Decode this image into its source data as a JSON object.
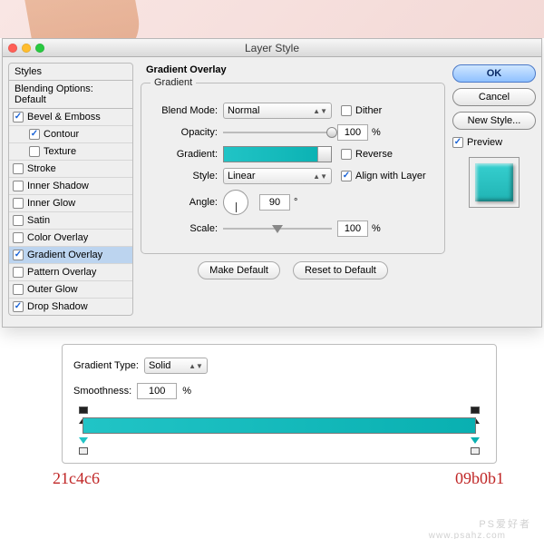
{
  "window": {
    "title": "Layer Style"
  },
  "left": {
    "styles_label": "Styles",
    "blend_label": "Blending Options: Default",
    "items": [
      {
        "label": "Bevel & Emboss",
        "checked": true,
        "indent": false
      },
      {
        "label": "Contour",
        "checked": true,
        "indent": true
      },
      {
        "label": "Texture",
        "checked": false,
        "indent": true
      },
      {
        "label": "Stroke",
        "checked": false,
        "indent": false
      },
      {
        "label": "Inner Shadow",
        "checked": false,
        "indent": false
      },
      {
        "label": "Inner Glow",
        "checked": false,
        "indent": false
      },
      {
        "label": "Satin",
        "checked": false,
        "indent": false
      },
      {
        "label": "Color Overlay",
        "checked": false,
        "indent": false
      },
      {
        "label": "Gradient Overlay",
        "checked": true,
        "indent": false,
        "selected": true
      },
      {
        "label": "Pattern Overlay",
        "checked": false,
        "indent": false
      },
      {
        "label": "Outer Glow",
        "checked": false,
        "indent": false
      },
      {
        "label": "Drop Shadow",
        "checked": true,
        "indent": false
      }
    ]
  },
  "center": {
    "section_title": "Gradient Overlay",
    "group_legend": "Gradient",
    "blend_mode_label": "Blend Mode:",
    "blend_mode_value": "Normal",
    "dither_label": "Dither",
    "dither_checked": false,
    "opacity_label": "Opacity:",
    "opacity_value": "100",
    "opacity_unit": "%",
    "gradient_label": "Gradient:",
    "reverse_label": "Reverse",
    "reverse_checked": false,
    "style_label": "Style:",
    "style_value": "Linear",
    "align_label": "Align with Layer",
    "align_checked": true,
    "angle_label": "Angle:",
    "angle_value": "90",
    "angle_unit": "°",
    "scale_label": "Scale:",
    "scale_value": "100",
    "scale_unit": "%",
    "make_default": "Make Default",
    "reset_default": "Reset to Default"
  },
  "right": {
    "ok": "OK",
    "cancel": "Cancel",
    "new_style": "New Style...",
    "preview_label": "Preview",
    "preview_checked": true
  },
  "editor": {
    "type_label": "Gradient Type:",
    "type_value": "Solid",
    "smooth_label": "Smoothness:",
    "smooth_value": "100",
    "smooth_unit": "%",
    "left_hex": "21c4c6",
    "right_hex": "09b0b1"
  },
  "watermark": {
    "main": "PS爱好者",
    "sub": "www.psahz.com"
  }
}
